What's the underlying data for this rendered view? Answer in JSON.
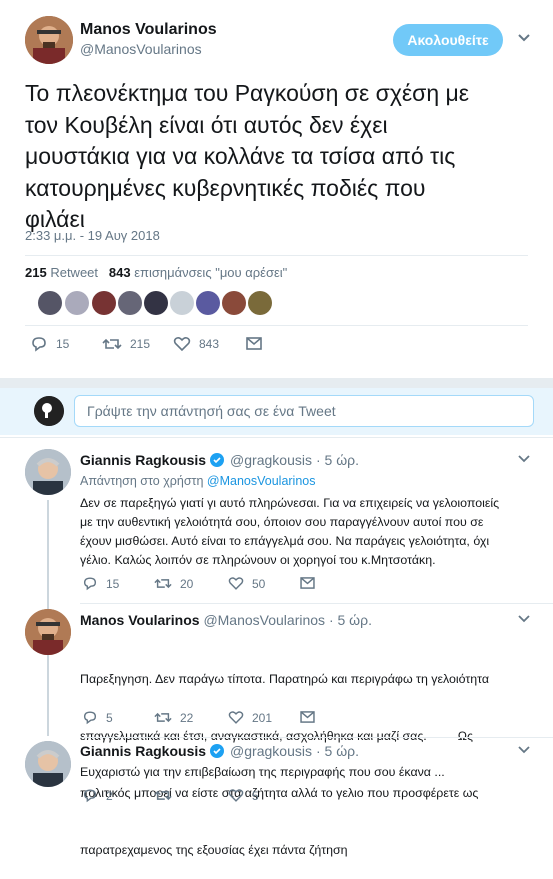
{
  "main_tweet": {
    "author_name": "Manos Voularinos",
    "author_handle": "@ManosVoularinos",
    "follow_label": "Ακολουθείτε",
    "text_lines": [
      "Το πλεονέκτημα του Ραγκούση σε σχέση με",
      "τον Κουβέλη είναι ότι αυτός δεν έχει",
      "μουστάκια για να κολλάνε τα τσίσα από τις",
      "κατουρημένες κυβερνητικές ποδιές που",
      "φιλάει"
    ],
    "timestamp": "2:33 μ.μ. - 19 Αυγ 2018",
    "retweet_count": "215",
    "retweet_label": "Retweet",
    "like_count": "843",
    "like_label": "επισημάνσεις \"μου αρέσει\"",
    "actions": {
      "replies": "15",
      "retweets": "215",
      "likes": "843"
    }
  },
  "reply_box": {
    "placeholder": "Γράψτε την απάντησή σας σε ένα Tweet"
  },
  "replies": [
    {
      "name": "Giannis Ragkousis",
      "handle": "@gragkousis",
      "time": "· 5 ώρ.",
      "reply_to_prefix": "Απάντηση στο χρήστη",
      "reply_to_handle": "@ManosVoularinos",
      "lines": [
        "Δεν σε παρεξηγώ γιατί γι αυτό πληρώνεσαι. Για να επιχειρείς να γελοιοποιείς",
        "με την αυθεντική γελοιότητά σου, όποιον σου παραγγέλνουν αυτοί που σε",
        "έχουν μισθώσει. Αυτό είναι το επάγγελμά σου. Να παράγεις γελοιότητα, όχι",
        "γέλιο. Καλώς λοιπόν σε πληρώνουν οι χορηγοί του κ.Μητσοτάκη."
      ],
      "actions": {
        "replies": "15",
        "retweets": "20",
        "likes": "50"
      }
    },
    {
      "name": "Manos Voularinos",
      "handle": "@ManosVoularinos",
      "time": "· 5 ώρ.",
      "lines": [
        "Παρεξηγηση. Δεν παράγω τίποτα. Παρατηρώ και περιγράφω τη γελοιότητα",
        "επαγγελματικά και έτσι, αναγκαστικά, ασχολήθηκα και μαζί σας.         Ως",
        "πολιτικός μπορεί να είστε στα αζήτητα αλλά το γελιο που προσφέρετε ως",
        "παρατρεχαμενος της εξουσίας έχει πάντα ζήτηση"
      ],
      "actions": {
        "replies": "5",
        "retweets": "22",
        "likes": "201"
      }
    },
    {
      "name": "Giannis Ragkousis",
      "handle": "@gragkousis",
      "time": "· 5 ώρ.",
      "lines": [
        "Ευχαριστώ για την επιβεβαίωση της περιγραφής που σου έκανα ..."
      ],
      "actions": {
        "replies": "2",
        "retweets": "",
        "likes": "5"
      }
    }
  ],
  "colors": {
    "accent": "#1b95e0",
    "follow_bg": "#71c9f8",
    "muted": "#657786",
    "divider": "#e6ecf0"
  }
}
